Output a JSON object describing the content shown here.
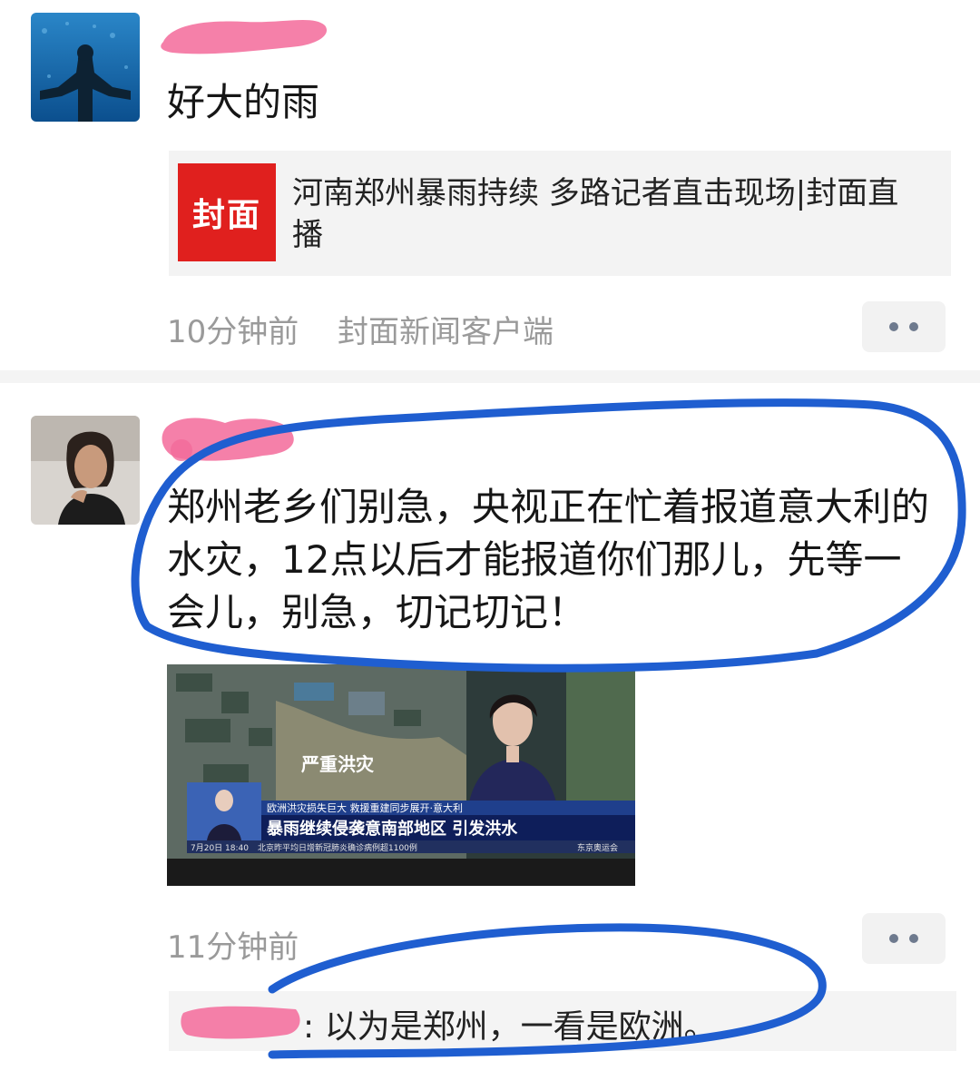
{
  "post1": {
    "text": "好大的雨",
    "link_card": {
      "logo": "封面",
      "title": "河南郑州暴雨持续 多路记者直击现场|封面直播"
    },
    "time": "10分钟前",
    "source": "封面新闻客户端"
  },
  "post2": {
    "text": "郑州老乡们别急，央视正在忙着报道意大利的水灾，12点以后才能报道你们那儿，先等一会儿，别急，切记切记！",
    "image": {
      "caption_big": "严重洪灾",
      "ticker_top": "欧洲洪灾损失巨大 救援重建同步展开·意大利",
      "ticker_main": "暴雨继续侵袭意南部地区 引发洪水",
      "date_time": "7月20日 18:40",
      "crawl": "北京昨平均日增新冠肺炎确诊病例超1100例",
      "channel": "东京奥运会"
    },
    "time": "11分钟前",
    "comment": {
      "text": ": 以为是郑州，一看是欧洲。"
    }
  },
  "colors": {
    "blur_pink": "#f36a9a",
    "scribble_blue": "#1f5ed0",
    "logo_red": "#e0201e"
  }
}
